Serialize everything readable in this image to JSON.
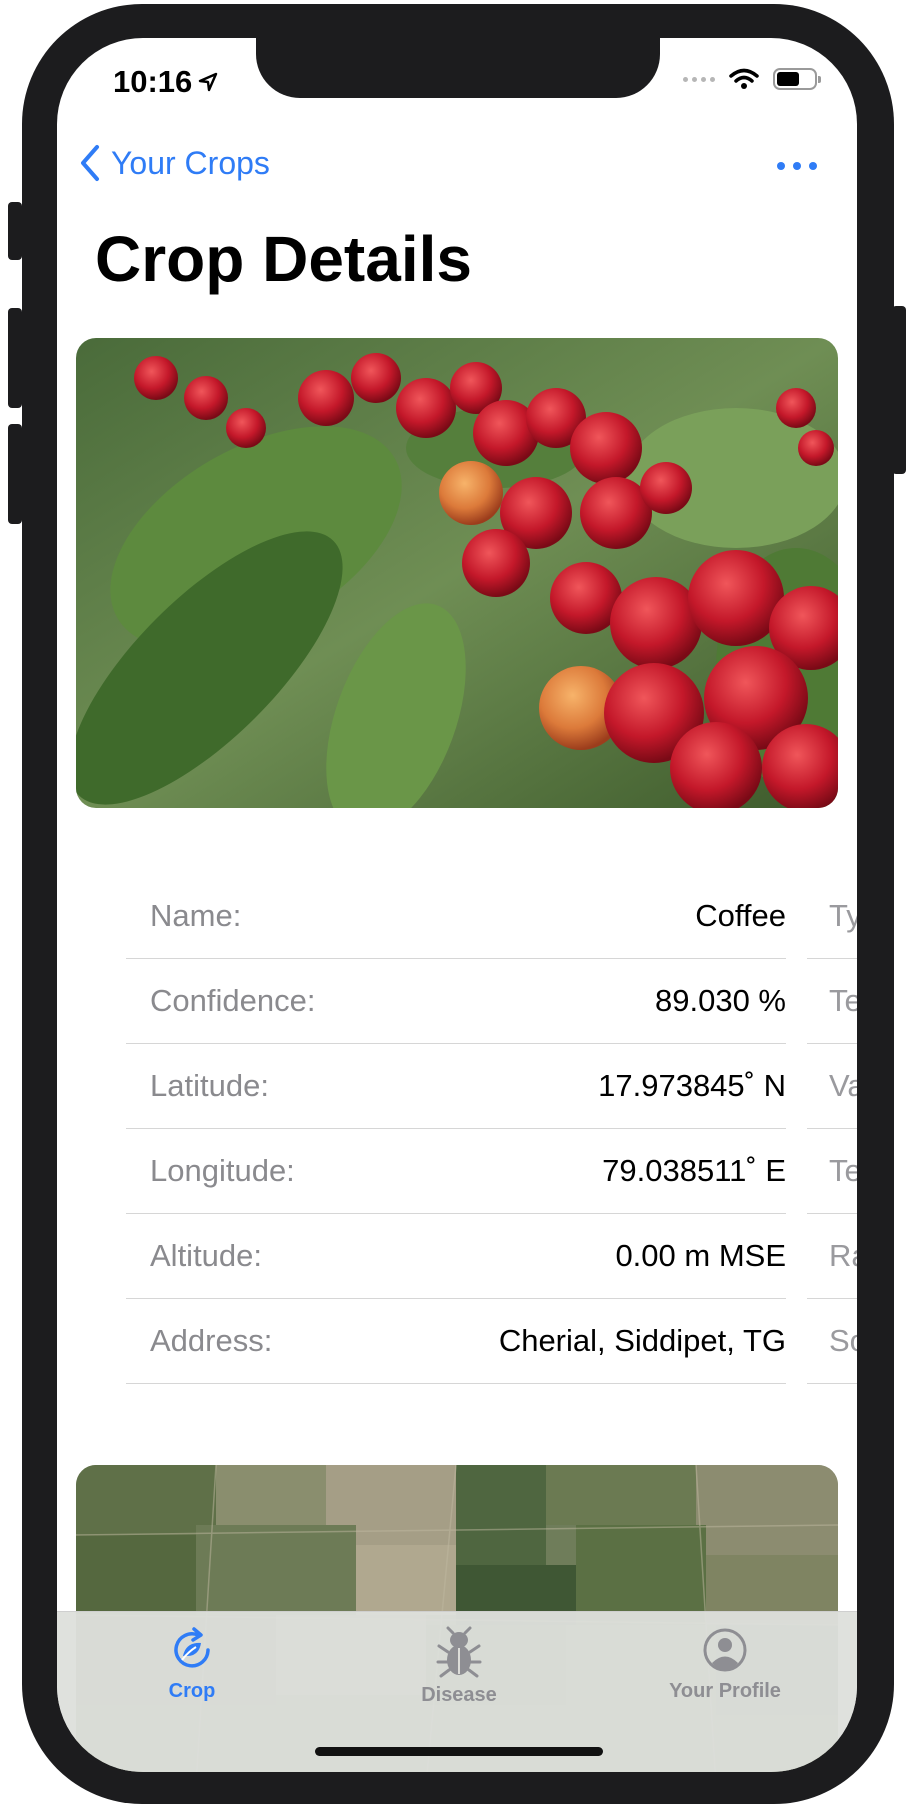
{
  "status_bar": {
    "time": "10:16"
  },
  "nav": {
    "back_label": "Your Crops",
    "more_icon": "ellipsis-icon"
  },
  "page": {
    "title": "Crop Details"
  },
  "details": [
    {
      "label": "Name:",
      "value": "Coffee"
    },
    {
      "label": "Confidence:",
      "value": "89.030 %"
    },
    {
      "label": "Latitude:",
      "value": "17.973845˚ N"
    },
    {
      "label": "Longitude:",
      "value": "79.038511˚ E"
    },
    {
      "label": "Altitude:",
      "value": "0.00 m MSE"
    },
    {
      "label": "Address:",
      "value": "Cherial, Siddipet, TG"
    }
  ],
  "details_overflow": [
    "Ty",
    "Te",
    "Va",
    "Te",
    "Ra",
    "So"
  ],
  "tabbar": {
    "tabs": [
      {
        "label": "Crop",
        "icon": "crop-refresh-icon",
        "active": true
      },
      {
        "label": "Disease",
        "icon": "bug-icon",
        "active": false
      },
      {
        "label": "Your Profile",
        "icon": "profile-icon",
        "active": false
      }
    ]
  },
  "colors": {
    "accent": "#2f7cf6",
    "inactive_tab": "#8e8e93",
    "label_gray": "#8a8a8e"
  }
}
